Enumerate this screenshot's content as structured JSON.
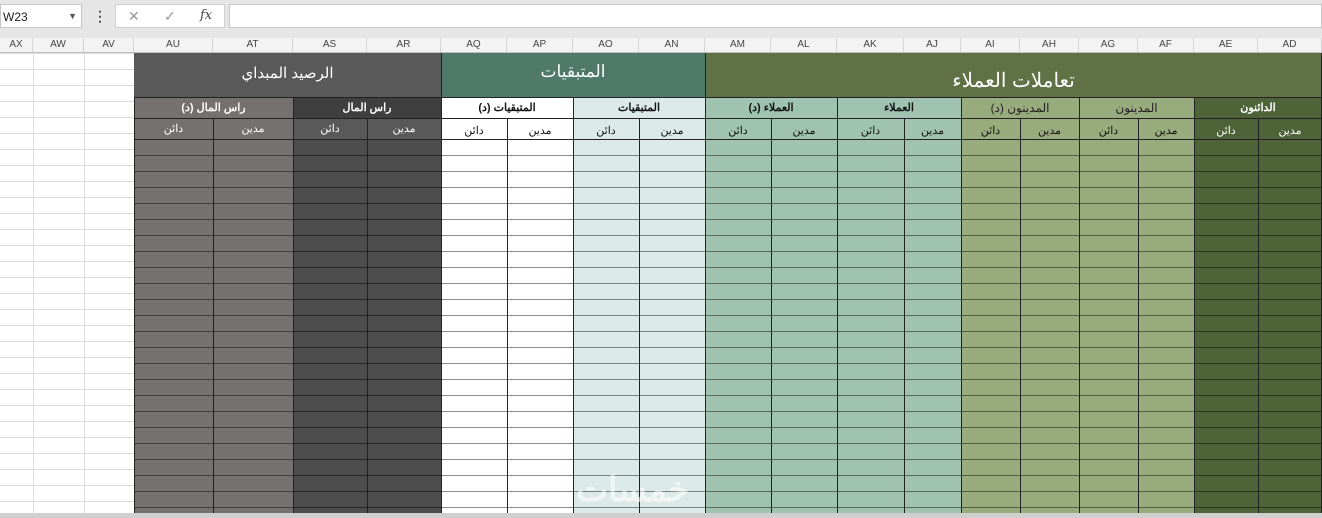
{
  "formula_bar": {
    "name_box": "W23",
    "name_box_dropdown_icon": "triangle-down-icon",
    "more_icon": "vertical-dots-icon",
    "cancel_icon": "x-icon",
    "enter_icon": "check-icon",
    "function_label": "fx",
    "formula_value": ""
  },
  "columns": [
    "AX",
    "AW",
    "AV",
    "AU",
    "AT",
    "AS",
    "AR",
    "AQ",
    "AP",
    "AO",
    "AN",
    "AM",
    "AL",
    "AK",
    "AJ",
    "AI",
    "AH",
    "AG",
    "AF",
    "AE",
    "AD"
  ],
  "sections": {
    "opening_balance": {
      "title": "الرصيد المبداي",
      "groups": [
        {
          "label": "راس المال (د)",
          "cols": [
            "مدين",
            "دائن"
          ]
        },
        {
          "label": "راس المال",
          "cols": [
            "مدين",
            "دائن"
          ]
        }
      ]
    },
    "remaining": {
      "title": "المتبقيات",
      "groups": [
        {
          "label": "المتبقيات  (د)",
          "cols": [
            "مدين",
            "دائن"
          ]
        },
        {
          "label": "المتبقيات",
          "cols": [
            "مدين",
            "دائن"
          ]
        }
      ]
    },
    "client_transactions": {
      "title": "تعاملات العملاء",
      "groups": [
        {
          "label": "العملاء (د)",
          "cols": [
            "مدين",
            "دائن"
          ]
        },
        {
          "label": "العملاء",
          "cols": [
            "مدين",
            "دائن"
          ]
        },
        {
          "label": "المدينون (د)",
          "cols": [
            "مدين",
            "دائن"
          ]
        },
        {
          "label": "المدينون",
          "cols": [
            "مدين",
            "دائن"
          ]
        },
        {
          "label": "الدائنون",
          "cols": [
            "مدين",
            "دائن"
          ]
        }
      ]
    }
  },
  "colors": {
    "gray_dark": "#595959",
    "gray_mid": "#757170",
    "gray_header": "#3f3f3f",
    "teal_title": "#4f7a6a",
    "teal_light": "#dbeae6",
    "green_light": "#9fc2b1",
    "olive_light": "#98ab7c",
    "olive_title": "#5f7145",
    "olive_dark": "#4f6339"
  },
  "watermark": "خمسات"
}
